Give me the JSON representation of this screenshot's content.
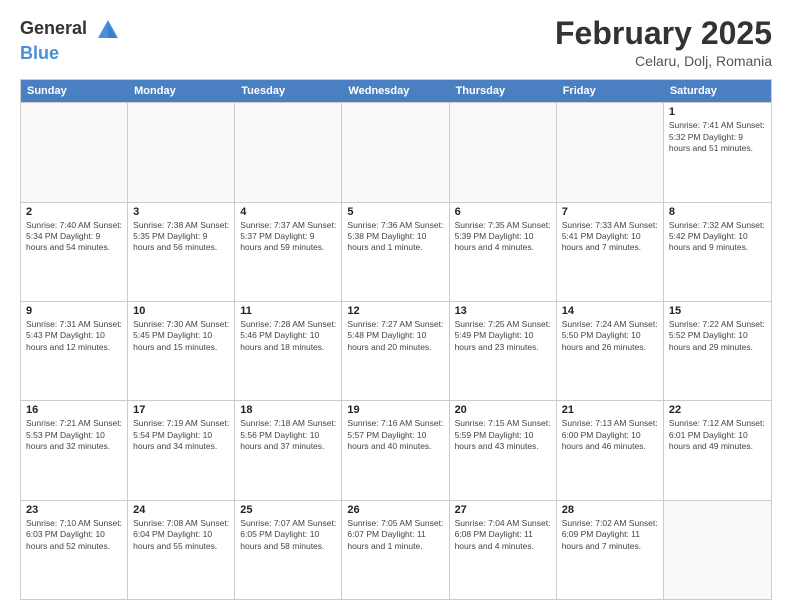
{
  "header": {
    "logo_general": "General",
    "logo_blue": "Blue",
    "main_title": "February 2025",
    "subtitle": "Celaru, Dolj, Romania"
  },
  "calendar": {
    "days_of_week": [
      "Sunday",
      "Monday",
      "Tuesday",
      "Wednesday",
      "Thursday",
      "Friday",
      "Saturday"
    ],
    "weeks": [
      [
        {
          "day": "",
          "info": "",
          "empty": true
        },
        {
          "day": "",
          "info": "",
          "empty": true
        },
        {
          "day": "",
          "info": "",
          "empty": true
        },
        {
          "day": "",
          "info": "",
          "empty": true
        },
        {
          "day": "",
          "info": "",
          "empty": true
        },
        {
          "day": "",
          "info": "",
          "empty": true
        },
        {
          "day": "1",
          "info": "Sunrise: 7:41 AM\nSunset: 5:32 PM\nDaylight: 9 hours and 51 minutes."
        }
      ],
      [
        {
          "day": "2",
          "info": "Sunrise: 7:40 AM\nSunset: 5:34 PM\nDaylight: 9 hours and 54 minutes."
        },
        {
          "day": "3",
          "info": "Sunrise: 7:38 AM\nSunset: 5:35 PM\nDaylight: 9 hours and 56 minutes."
        },
        {
          "day": "4",
          "info": "Sunrise: 7:37 AM\nSunset: 5:37 PM\nDaylight: 9 hours and 59 minutes."
        },
        {
          "day": "5",
          "info": "Sunrise: 7:36 AM\nSunset: 5:38 PM\nDaylight: 10 hours and 1 minute."
        },
        {
          "day": "6",
          "info": "Sunrise: 7:35 AM\nSunset: 5:39 PM\nDaylight: 10 hours and 4 minutes."
        },
        {
          "day": "7",
          "info": "Sunrise: 7:33 AM\nSunset: 5:41 PM\nDaylight: 10 hours and 7 minutes."
        },
        {
          "day": "8",
          "info": "Sunrise: 7:32 AM\nSunset: 5:42 PM\nDaylight: 10 hours and 9 minutes."
        }
      ],
      [
        {
          "day": "9",
          "info": "Sunrise: 7:31 AM\nSunset: 5:43 PM\nDaylight: 10 hours and 12 minutes."
        },
        {
          "day": "10",
          "info": "Sunrise: 7:30 AM\nSunset: 5:45 PM\nDaylight: 10 hours and 15 minutes."
        },
        {
          "day": "11",
          "info": "Sunrise: 7:28 AM\nSunset: 5:46 PM\nDaylight: 10 hours and 18 minutes."
        },
        {
          "day": "12",
          "info": "Sunrise: 7:27 AM\nSunset: 5:48 PM\nDaylight: 10 hours and 20 minutes."
        },
        {
          "day": "13",
          "info": "Sunrise: 7:25 AM\nSunset: 5:49 PM\nDaylight: 10 hours and 23 minutes."
        },
        {
          "day": "14",
          "info": "Sunrise: 7:24 AM\nSunset: 5:50 PM\nDaylight: 10 hours and 26 minutes."
        },
        {
          "day": "15",
          "info": "Sunrise: 7:22 AM\nSunset: 5:52 PM\nDaylight: 10 hours and 29 minutes."
        }
      ],
      [
        {
          "day": "16",
          "info": "Sunrise: 7:21 AM\nSunset: 5:53 PM\nDaylight: 10 hours and 32 minutes."
        },
        {
          "day": "17",
          "info": "Sunrise: 7:19 AM\nSunset: 5:54 PM\nDaylight: 10 hours and 34 minutes."
        },
        {
          "day": "18",
          "info": "Sunrise: 7:18 AM\nSunset: 5:56 PM\nDaylight: 10 hours and 37 minutes."
        },
        {
          "day": "19",
          "info": "Sunrise: 7:16 AM\nSunset: 5:57 PM\nDaylight: 10 hours and 40 minutes."
        },
        {
          "day": "20",
          "info": "Sunrise: 7:15 AM\nSunset: 5:59 PM\nDaylight: 10 hours and 43 minutes."
        },
        {
          "day": "21",
          "info": "Sunrise: 7:13 AM\nSunset: 6:00 PM\nDaylight: 10 hours and 46 minutes."
        },
        {
          "day": "22",
          "info": "Sunrise: 7:12 AM\nSunset: 6:01 PM\nDaylight: 10 hours and 49 minutes."
        }
      ],
      [
        {
          "day": "23",
          "info": "Sunrise: 7:10 AM\nSunset: 6:03 PM\nDaylight: 10 hours and 52 minutes."
        },
        {
          "day": "24",
          "info": "Sunrise: 7:08 AM\nSunset: 6:04 PM\nDaylight: 10 hours and 55 minutes."
        },
        {
          "day": "25",
          "info": "Sunrise: 7:07 AM\nSunset: 6:05 PM\nDaylight: 10 hours and 58 minutes."
        },
        {
          "day": "26",
          "info": "Sunrise: 7:05 AM\nSunset: 6:07 PM\nDaylight: 11 hours and 1 minute."
        },
        {
          "day": "27",
          "info": "Sunrise: 7:04 AM\nSunset: 6:08 PM\nDaylight: 11 hours and 4 minutes."
        },
        {
          "day": "28",
          "info": "Sunrise: 7:02 AM\nSunset: 6:09 PM\nDaylight: 11 hours and 7 minutes."
        },
        {
          "day": "",
          "info": "",
          "empty": true
        }
      ]
    ]
  }
}
